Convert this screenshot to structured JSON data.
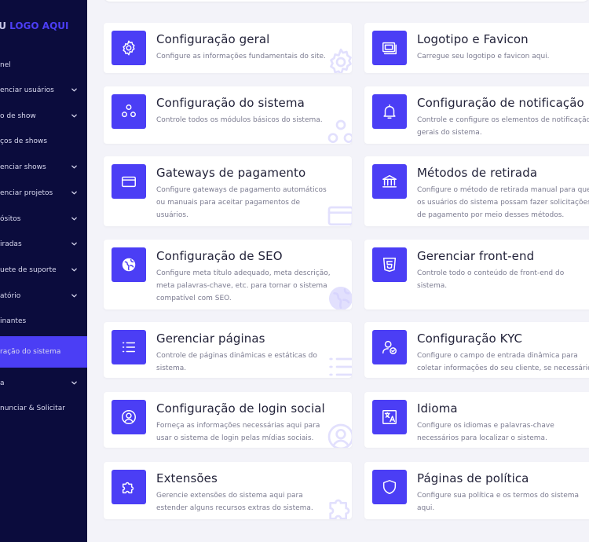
{
  "logo": {
    "prefix": "EU",
    "main": "LOGO AQUI"
  },
  "sidebar": {
    "items": [
      {
        "label": "nel",
        "has_chevron": false,
        "active": false
      },
      {
        "label": "enciar usuários",
        "has_chevron": true,
        "active": false
      },
      {
        "label": "o de show",
        "has_chevron": true,
        "active": false
      },
      {
        "label": "ços de shows",
        "has_chevron": false,
        "active": false
      },
      {
        "label": "enciar shows",
        "has_chevron": true,
        "active": false
      },
      {
        "label": "enciar projetos",
        "has_chevron": true,
        "active": false
      },
      {
        "label": "ósitos",
        "has_chevron": true,
        "active": false
      },
      {
        "label": "iradas",
        "has_chevron": true,
        "active": false
      },
      {
        "label": "uete de suporte",
        "has_chevron": true,
        "active": false
      },
      {
        "label": "atório",
        "has_chevron": true,
        "active": false
      },
      {
        "label": "inantes",
        "has_chevron": false,
        "active": false
      },
      {
        "label": "ração do sistema",
        "has_chevron": false,
        "active": true
      },
      {
        "label": "a",
        "has_chevron": true,
        "active": false
      },
      {
        "label": "nunciar & Solicitar",
        "has_chevron": false,
        "active": false
      }
    ]
  },
  "colors": {
    "accent": "#4b3ef5",
    "sidebar_bg": "#0b0c3d",
    "page_bg": "#f3f3f9"
  },
  "cards": [
    {
      "icon": "gear-icon",
      "title": "Configuração geral",
      "desc": [
        "Configure as informações fundamentais do site."
      ]
    },
    {
      "icon": "image-icon",
      "title": "Logotipo e Favicon",
      "desc": [
        "Carregue seu logotipo e favicon aqui."
      ]
    },
    {
      "icon": "modules-icon",
      "title": "Configuração do sistema",
      "desc": [
        "Controle todos os módulos básicos do sistema."
      ]
    },
    {
      "icon": "bell-icon",
      "title": "Configuração de notificação",
      "desc": [
        "Controle e configure os elementos de notificação",
        "gerais do sistema."
      ]
    },
    {
      "icon": "credit-card-icon",
      "title": "Gateways de pagamento",
      "desc": [
        "Configure gateways de pagamento automáticos",
        "ou manuais para aceitar pagamentos de",
        "usuários."
      ]
    },
    {
      "icon": "bank-icon",
      "title": "Métodos de retirada",
      "desc": [
        "Configure o método de retirada manual para que",
        "os usuários do sistema possam fazer solicitações",
        "de pagamento por meio desses métodos."
      ]
    },
    {
      "icon": "globe-icon",
      "title": "Configuração de SEO",
      "desc": [
        "Configure meta título adequado, meta descrição,",
        "meta palavras-chave, etc. para tornar o sistema",
        "compatível com SEO."
      ]
    },
    {
      "icon": "html5-icon",
      "title": "Gerenciar front-end",
      "desc": [
        "Controle todo o conteúdo de front-end do",
        "sistema."
      ]
    },
    {
      "icon": "list-icon",
      "title": "Gerenciar páginas",
      "desc": [
        "Controle de páginas dinâmicas e estáticas do",
        "sistema."
      ]
    },
    {
      "icon": "user-check-icon",
      "title": "Configuração KYC",
      "desc": [
        "Configure o campo de entrada dinâmica para",
        "coletar informações do seu cliente, se necessário."
      ]
    },
    {
      "icon": "user-circle-icon",
      "title": "Configuração de login social",
      "desc": [
        "Forneça as informações necessárias aqui para",
        "usar o sistema de login pelas mídias sociais."
      ]
    },
    {
      "icon": "translate-icon",
      "title": "Idioma",
      "desc": [
        "Configure os idiomas e palavras-chave",
        "necessários para localizar o sistema."
      ]
    },
    {
      "icon": "puzzle-icon",
      "title": "Extensões",
      "desc": [
        "Gerencie extensões do sistema aqui para",
        "estender alguns recursos extras do sistema."
      ]
    },
    {
      "icon": "shield-icon",
      "title": "Páginas de política",
      "desc": [
        "Configure sua política e os termos do sistema",
        "aqui."
      ]
    }
  ]
}
